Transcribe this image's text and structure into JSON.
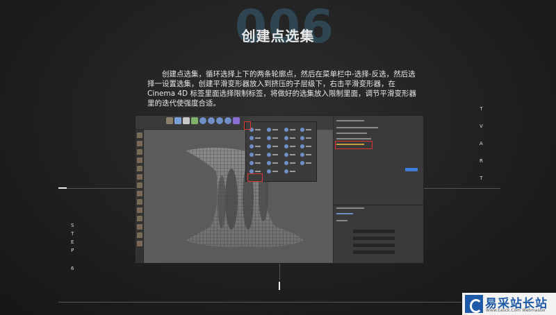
{
  "header": {
    "step_number": "006",
    "title": "创建点选集"
  },
  "description": {
    "lines": [
      "　　创建点选集，循环选择上下的两条轮廓点，然后在菜单栏中-选择-反选，然后选",
      "择一设置选集，创建平滑变形器放入到挤压的子层级下，右击平滑变形器，在",
      "Cinema 4D 标签里面选择限制标签，将做好的选集放入限制里面，调节平滑变形器",
      "里的迭代使强度合适。"
    ]
  },
  "side_labels": {
    "step": [
      "S",
      "T",
      "E",
      "P",
      "6"
    ],
    "brand": [
      "T",
      "V",
      "A",
      "R",
      "T"
    ]
  },
  "logo": {
    "text": "易采站长站",
    "subtitle": "Www.Easck.Com  Webmaster"
  },
  "colors": {
    "background": "#202020",
    "accent_number": "#2f4552",
    "highlight": "#dd3333",
    "logo_blue": "#1e5aa7"
  }
}
